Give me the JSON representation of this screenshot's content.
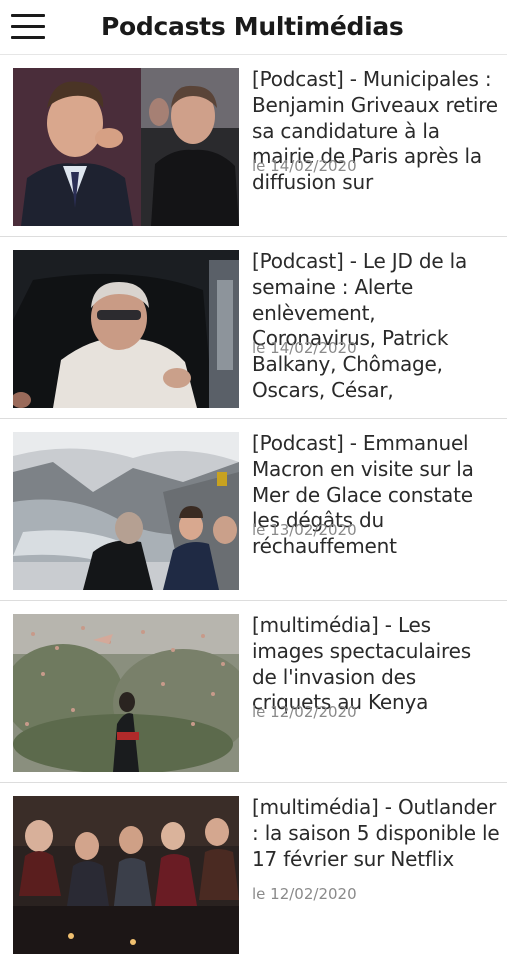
{
  "header": {
    "title": "Podcasts Multimédias"
  },
  "articles": [
    {
      "title": "[Podcast] - Municipales : Benjamin Griveaux retire sa candidature à la mairie de Paris après la diffusion sur",
      "date": "le 14/02/2020",
      "image": "two-men-portraits"
    },
    {
      "title": "[Podcast] - Le JD de la semaine : Alerte enlèvement, Coronavirus, Patrick Balkany, Chômage, Oscars, César,",
      "date": "le 14/02/2020",
      "image": "man-in-car"
    },
    {
      "title": "[Podcast] - Emmanuel Macron en visite sur la Mer de Glace constate les dégâts du réchauffement",
      "date": "le 13/02/2020",
      "image": "glacier-visit"
    },
    {
      "title": "[multimédia] - Les images spectaculaires de l'invasion des criquets au Kenya",
      "date": "le 12/02/2020",
      "image": "locust-swarm"
    },
    {
      "title": "[multimédia] - Outlander : la saison 5 disponible le 17 février sur Netflix",
      "date": "le 12/02/2020",
      "image": "tv-series-cast"
    }
  ],
  "colors": {
    "header_text": "#1a1a1a",
    "title_text": "#2a2a2a",
    "date_text": "#8a8a8a",
    "divider": "#dddddd"
  }
}
